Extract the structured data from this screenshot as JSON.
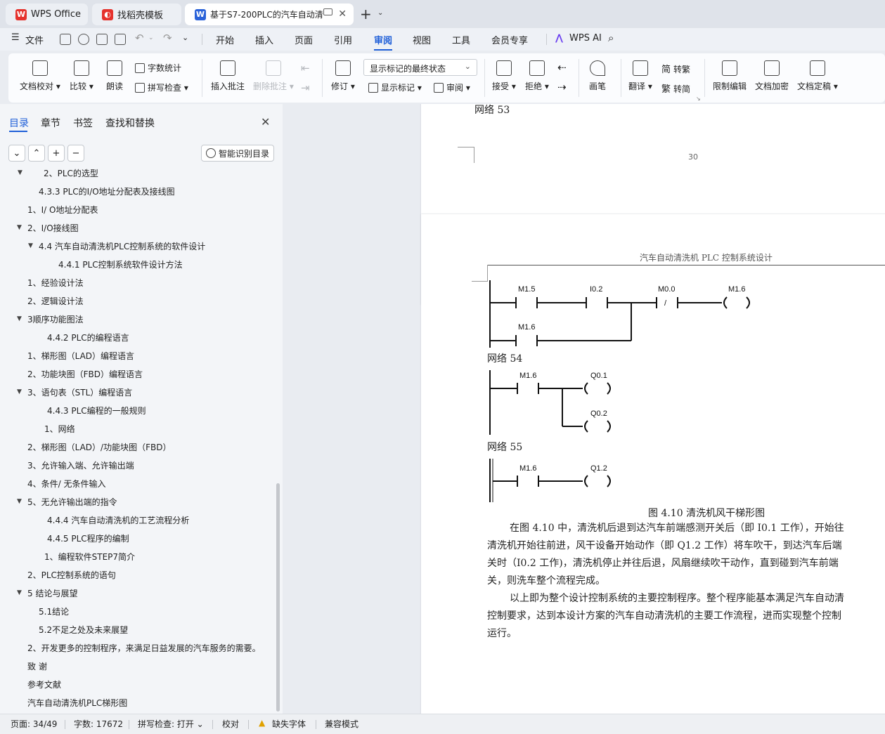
{
  "tabs": [
    {
      "label": "WPS Office",
      "active": false
    },
    {
      "label": "找稻壳模板",
      "active": false
    },
    {
      "label": "基于S7-200PLC的汽车自动清",
      "active": true
    }
  ],
  "menubar": {
    "file": "文件",
    "items": [
      "开始",
      "插入",
      "页面",
      "引用",
      "审阅",
      "视图",
      "工具",
      "会员专享"
    ],
    "active": "审阅",
    "ai": "WPS AI"
  },
  "ribbon": {
    "doc_check": "文档校对",
    "compare": "比较",
    "read_aloud": "朗读",
    "word_count": "字数统计",
    "spell_check": "拼写检查",
    "insert_comment": "插入批注",
    "delete_comment": "删除批注",
    "revise": "修订",
    "markup_select": "显示标记的最终状态",
    "show_markup": "显示标记",
    "review": "审阅",
    "accept": "接受",
    "reject": "拒绝",
    "pen": "画笔",
    "translate": "翻译",
    "to_trad": "转繁",
    "to_simp": "转简",
    "restrict": "限制编辑",
    "encrypt": "文档加密",
    "finalize": "文档定稿",
    "glyph_trad": "简",
    "glyph_simp": "繁"
  },
  "sidebar": {
    "tabs": [
      "目录",
      "章节",
      "书签",
      "查找和替换"
    ],
    "smart_toc": "智能识别目录",
    "toc": [
      {
        "text": "2、PLC的选型",
        "caret": true
      },
      {
        "text": "4.3.3 PLC的I/O地址分配表及接线图",
        "caret": false
      },
      {
        "text": "1、I/ O地址分配表",
        "caret": false
      },
      {
        "text": "2、I/O接线图",
        "caret": true
      },
      {
        "text": "4.4  汽车自动清洗机PLC控制系统的软件设计",
        "caret": true
      },
      {
        "text": "4.4.1 PLC控制系统软件设计方法",
        "caret": false
      },
      {
        "text": "1、经验设计法",
        "caret": false
      },
      {
        "text": "2、逻辑设计法",
        "caret": false
      },
      {
        "text": "3顺序功能图法",
        "caret": true
      },
      {
        "text": "4.4.2 PLC的编程语言",
        "caret": false
      },
      {
        "text": "1、梯形图（LAD）编程语言",
        "caret": false
      },
      {
        "text": "2、功能块图（FBD）编程语言",
        "caret": false
      },
      {
        "text": "3、语句表（STL）编程语言",
        "caret": true
      },
      {
        "text": "4.4.3 PLC编程的一般规则",
        "caret": false
      },
      {
        "text": "1、网络",
        "caret": false
      },
      {
        "text": "2、梯形图（LAD）/功能块图（FBD）",
        "caret": false
      },
      {
        "text": "3、允许输入端、允许输出端",
        "caret": false
      },
      {
        "text": "4、条件/ 无条件输入",
        "caret": false
      },
      {
        "text": "5、无允许输出端的指令",
        "caret": true
      },
      {
        "text": "4.4.4  汽车自动清洗机的工艺流程分析",
        "caret": false
      },
      {
        "text": "4.4.5 PLC程序的编制",
        "caret": false
      },
      {
        "text": "1、编程软件STEP7简介",
        "caret": false
      },
      {
        "text": "2、PLC控制系统的语句",
        "caret": false
      },
      {
        "text": "5  结论与展望",
        "caret": true
      },
      {
        "text": "5.1结论",
        "caret": false
      },
      {
        "text": "5.2不足之处及未来展望",
        "caret": false
      },
      {
        "text": "2、开发更多的控制程序，来满足日益发展的汽车服务的需要。",
        "caret": false
      },
      {
        "text": "致   谢",
        "caret": false
      },
      {
        "text": "参考文献",
        "caret": false
      },
      {
        "text": "汽车自动清洗机PLC梯形图",
        "caret": false
      }
    ]
  },
  "document": {
    "prev_page": {
      "network": "网络 53",
      "page_number": "30"
    },
    "header": "汽车自动清洗机 PLC 控制系统设计",
    "network53": {
      "contacts": [
        "M1.5",
        "I0.2",
        "M0.0"
      ],
      "nc_mark": "/",
      "coil": "M1.6",
      "branch": "M1.6"
    },
    "network54": {
      "label": "网络 54",
      "contact": "M1.6",
      "coils": [
        "Q0.1",
        "Q0.2"
      ]
    },
    "network55": {
      "label": "网络 55",
      "contact": "M1.6",
      "coil": "Q1.2"
    },
    "caption": "图 4.10 清洗机风干梯形图",
    "paragraph1": [
      "在图 4.10 中，清洗机后退到达汽车前端感测开关后（即 I0.1 工作），开始往",
      "清洗机开始往前进，风干设备开始动作（即 Q1.2 工作）将车吹干，到达汽车后端",
      "关时（I0.2 工作)，清洗机停止并往后退，风扇继续吹干动作，直到碰到汽车前端",
      "关，则洗车整个流程完成。"
    ],
    "paragraph2": [
      "以上即为整个设计控制系统的主要控制程序。整个程序能基本满足汽车自动清",
      "控制要求，达到本设计方案的汽车自动清洗机的主要工作流程，进而实现整个控制",
      "运行。"
    ]
  },
  "status": {
    "page": "页面: 34/49",
    "words": "字数: 17672",
    "spell": "拼写检查: 打开",
    "proof": "校对",
    "missing_font": "缺失字体",
    "compat": "兼容模式"
  }
}
